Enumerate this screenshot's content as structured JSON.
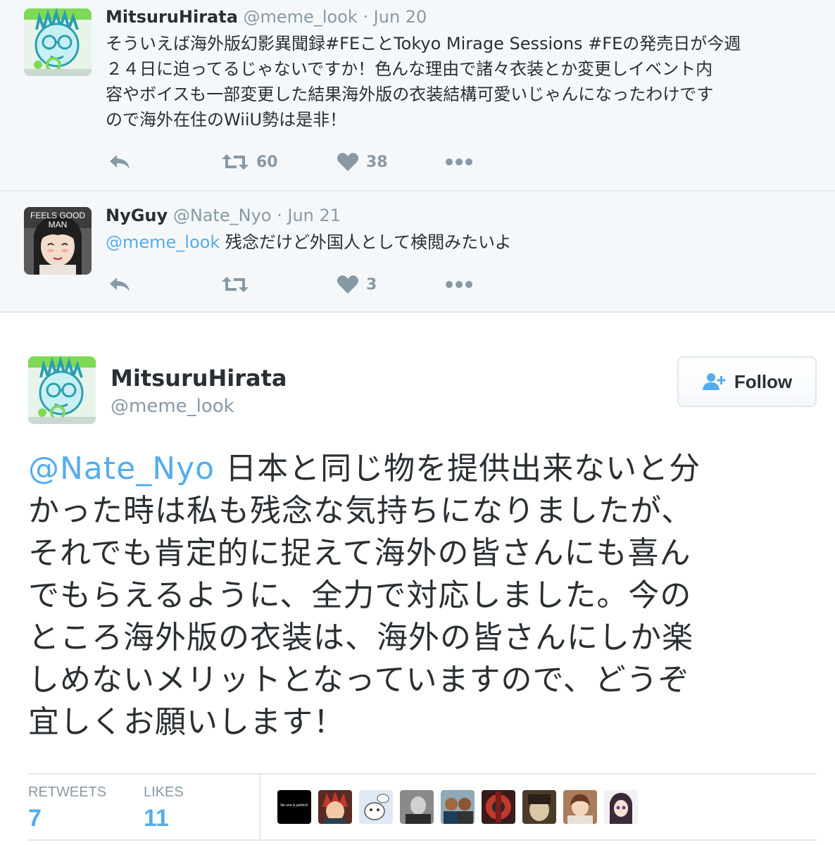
{
  "thread": [
    {
      "name": "MitsuruHirata",
      "handle": "@meme_look",
      "separator": " · ",
      "date": "Jun 20",
      "text_lines": [
        "そういえば海外版幻影異聞録#FEことTokyo Mirage Sessions #FEの発売日が今週",
        "２４日に迫ってるじゃないですか！色んな理由で諸々衣装とか変更しイベント内",
        "容やボイスも一部変更した結果海外版の衣装結構可愛いじゃんになったわけです",
        "ので海外在住のWiiU勢は是非！"
      ],
      "retweets": "60",
      "likes": "38",
      "icons": [
        "reply-icon",
        "retweet-icon",
        "like-icon",
        "more-icon"
      ]
    },
    {
      "name": "NyGuy",
      "handle": "@Nate_Nyo",
      "separator": " · ",
      "date": "Jun 21",
      "avatar_caption": "FEELS GOOD MAN",
      "mention": "@meme_look",
      "text": " 残念だけど外国人として検閲みたいよ",
      "retweets": "",
      "likes": "3",
      "icons": [
        "reply-icon",
        "retweet-icon",
        "like-icon",
        "more-icon"
      ]
    }
  ],
  "main_tweet": {
    "name": "MitsuruHirata",
    "handle": "@meme_look",
    "follow_label": "Follow",
    "mention": "@Nate_Nyo",
    "text_first_line": " 日本と同じ物を提供出来ないと分",
    "text_lines": [
      "かった時は私も残念な気持ちになりましたが、",
      "それでも肯定的に捉えて海外の皆さんにも喜ん",
      "でもらえるように、全力で対応しました。今の",
      "ところ海外版の衣装は、海外の皆さんにしか楽",
      "しめないメリットとなっていますので、どうぞ",
      "宜しくお願いします！"
    ],
    "stats": {
      "retweets_label": "RETWEETS",
      "retweets_value": "7",
      "likes_label": "LIKES",
      "likes_value": "11"
    },
    "liker_avatar_caption": "No one is perfect!"
  },
  "colors": {
    "link": "#55acee",
    "muted": "#8899a6",
    "text": "#292f33",
    "thread_bg": "#f5f8fa",
    "border": "#e1e8ed"
  }
}
